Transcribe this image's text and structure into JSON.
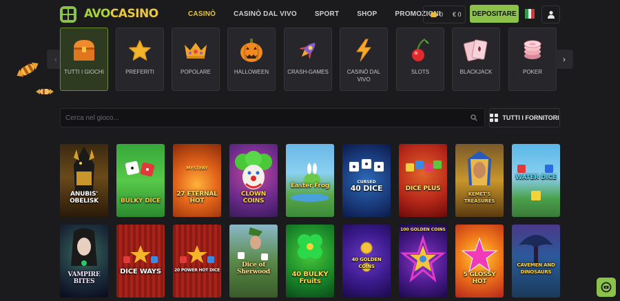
{
  "brand": {
    "name_part1": "AVO",
    "name_part2": "CASINO"
  },
  "nav": [
    "CASINÒ",
    "CASINÒ DAL VIVO",
    "SPORT",
    "SHOP",
    "PROMOZIONI"
  ],
  "wallet": {
    "coins": "0",
    "balance": "€ 0"
  },
  "deposit_label": "DEPOSITARE",
  "colors": {
    "accent": "#8bc34a",
    "nav_active": "#e8c845",
    "background": "#1b1b1d"
  },
  "categories": [
    {
      "label": "TUTTI I GIOCHI",
      "icon": "treasure-chest-icon",
      "glyph": "🧰"
    },
    {
      "label": "PREFERITI",
      "icon": "star-icon",
      "glyph": "⭐"
    },
    {
      "label": "POPOLARE",
      "icon": "crown-icon",
      "glyph": "👑"
    },
    {
      "label": "HALLOWEEN",
      "icon": "pumpkin-icon",
      "glyph": "🎃"
    },
    {
      "label": "CRASH-GAMES",
      "icon": "rocket-icon",
      "glyph": "🚀"
    },
    {
      "label": "CASINÒ DAL VIVO",
      "icon": "lightning-icon",
      "glyph": "⚡"
    },
    {
      "label": "SLOTS",
      "icon": "cherry-icon",
      "glyph": "🍒"
    },
    {
      "label": "BLACKJACK",
      "icon": "cards-icon",
      "glyph": "🂡"
    },
    {
      "label": "POKER",
      "icon": "poker-chip-icon",
      "glyph": "🎲"
    }
  ],
  "search": {
    "placeholder": "Cerca nel gioco..."
  },
  "providers_label": "TUTTI I FORNITORI",
  "games_row1": [
    {
      "title": "ANUBIS' OBELISK",
      "top": ""
    },
    {
      "title": "BULKY DICE",
      "top": ""
    },
    {
      "title": "27 ETERNAL HOT",
      "top": "MYSTERY"
    },
    {
      "title": "CLOWN COINS",
      "top": ""
    },
    {
      "title": "Easter Frog",
      "top": ""
    },
    {
      "title": "40 DICE",
      "top": "CURSED"
    },
    {
      "title": "DICE PLUS",
      "top": ""
    },
    {
      "title": "KEMET'S TREASURES",
      "top": ""
    },
    {
      "title": "WATER DICE",
      "top": ""
    }
  ],
  "games_row2": [
    {
      "title": "VAMPIRE BITES",
      "top": ""
    },
    {
      "title": "DICE WAYS",
      "top": ""
    },
    {
      "title": "20 POWER HOT DICE",
      "top": ""
    },
    {
      "title": "Dice of Sherwood",
      "top": ""
    },
    {
      "title": "40 BULKY Fruits",
      "top": ""
    },
    {
      "title": "40 GOLDEN COINS",
      "top": ""
    },
    {
      "title": "",
      "top": "100 GOLDEN COINS"
    },
    {
      "title": "5 GLOSSY HOT",
      "top": ""
    },
    {
      "title": "CAVEMEN AND DINOSAURS",
      "top": ""
    }
  ]
}
